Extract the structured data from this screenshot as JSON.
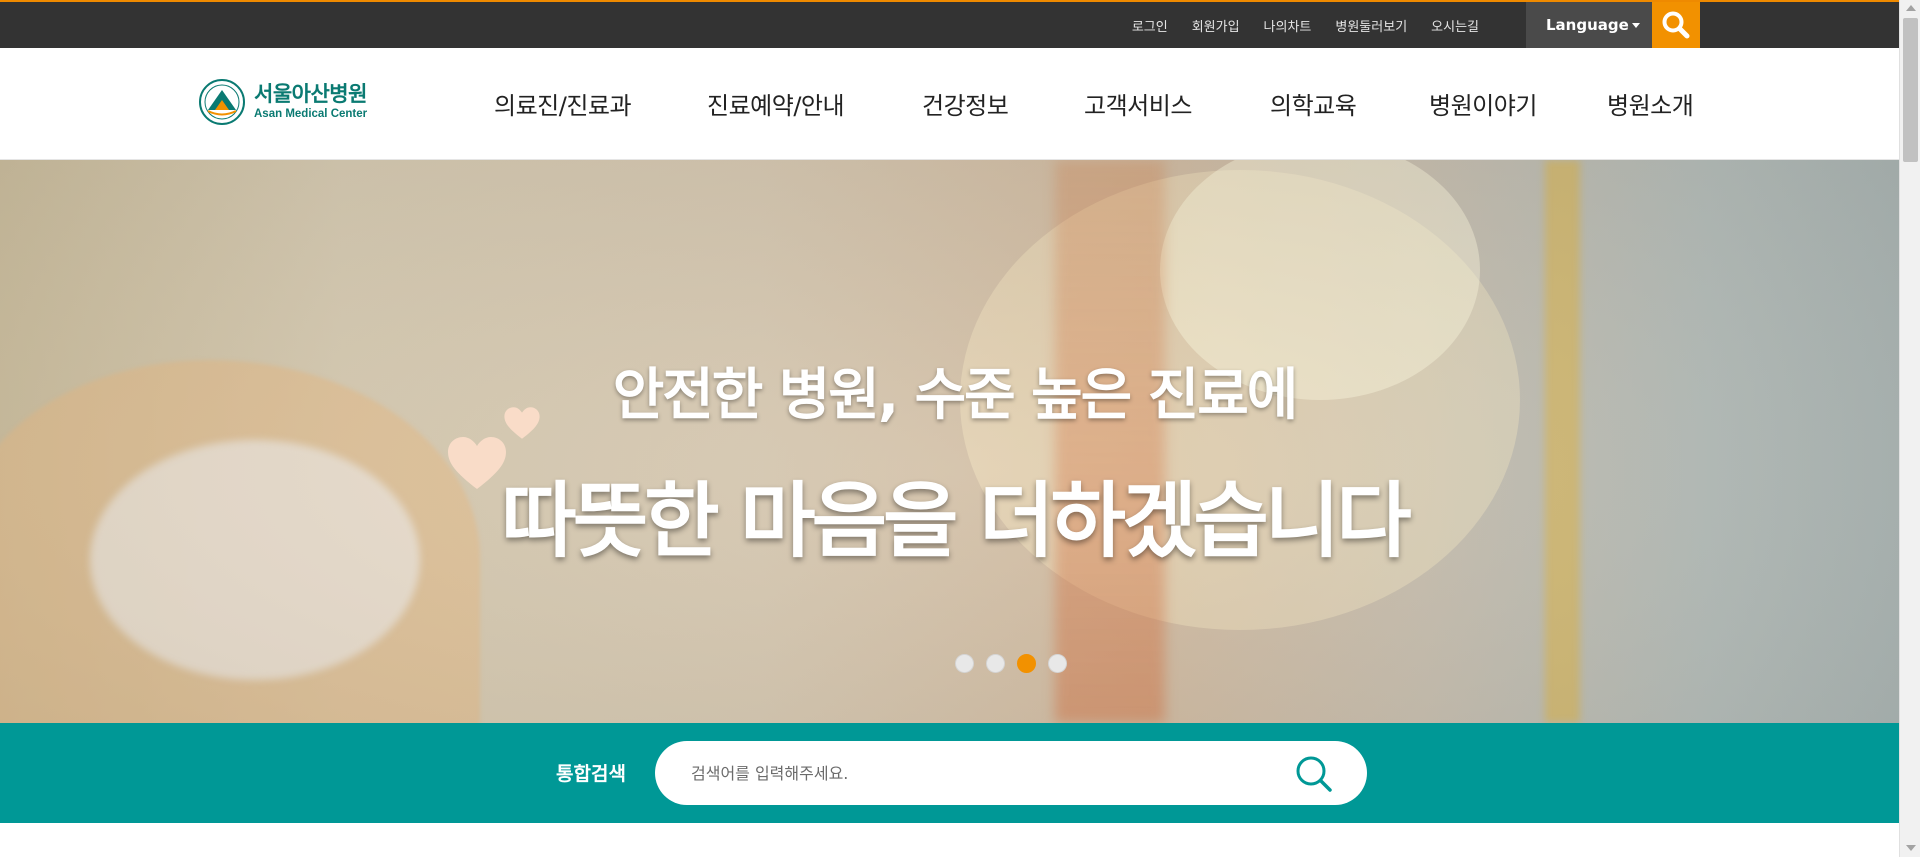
{
  "utility_nav": {
    "items": [
      "로그인",
      "회원가입",
      "나의차트",
      "병원둘러보기",
      "오시는길"
    ],
    "language_label": "Language"
  },
  "logo": {
    "korean": "서울아산병원",
    "english": "Asan Medical Center"
  },
  "main_nav": {
    "items": [
      "의료진/진료과",
      "진료예약/안내",
      "건강정보",
      "고객서비스",
      "의학교육",
      "병원이야기",
      "병원소개"
    ]
  },
  "hero": {
    "line1": "안전한 병원, 수준 높은 진료에",
    "line2": "따뜻한 마음을 더하겠습니다",
    "slide_count": 4,
    "active_slide": 3
  },
  "search": {
    "label": "통합검색",
    "placeholder": "검색어를 입력해주세요."
  },
  "colors": {
    "accent_orange": "#f29100",
    "teal": "#009896",
    "topbar": "#333333",
    "logo_green": "#0a7a72"
  },
  "icons": [
    "search-icon",
    "dropdown-caret-icon",
    "heart-icon",
    "logo-emblem-icon"
  ]
}
